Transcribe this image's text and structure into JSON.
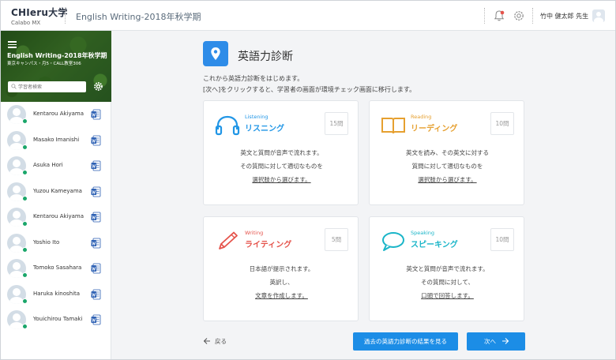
{
  "header": {
    "brand": "CHIeru大学",
    "brand_sub": "Calabo MX",
    "course_title": "English Writing-2018年秋学期",
    "teacher": "竹中 健太郎 先生",
    "icons": [
      "bell-icon",
      "gear-icon",
      "user-avatar-icon"
    ],
    "bell_badge_color": "#e5534b"
  },
  "sidebar": {
    "course": "English Writing-2018年秋学期",
    "place": "東京キャンパス・月5・CALL教室306",
    "search_placeholder": "学習者検索",
    "students": [
      {
        "name": "Kentarou Akiyama"
      },
      {
        "name": "Masako Imanishi"
      },
      {
        "name": "Asuka Hori"
      },
      {
        "name": "Yuzou Kameyama"
      },
      {
        "name": "Kentarou Akiyama"
      },
      {
        "name": "Yoshio Ito"
      },
      {
        "name": "Tomoko Sasahara"
      },
      {
        "name": "Haruka kinoshita"
      },
      {
        "name": "Youichirou Tamaki"
      }
    ],
    "online_color": "#1aa66a",
    "word_icon_color": "#2b5fb3"
  },
  "main": {
    "title": "英語力診断",
    "intro1": "これから英語力診断をはじめます。",
    "intro2": "[次へ]をクリックすると、学習者の画面が環境チェック画面に移行します。",
    "cards": [
      {
        "en": "Listening",
        "jp": "リスニング",
        "count": "15問",
        "lines": [
          "英文と質問が音声で流れます。",
          "その質問に対して適切なものを",
          "選択肢から選びます。"
        ],
        "color": "#2196e6",
        "icon": "headphones-icon"
      },
      {
        "en": "Reading",
        "jp": "リーディング",
        "count": "10問",
        "lines": [
          "英文を読み、その英文に対する",
          "質問に対して適切なものを",
          "選択肢から選びます。"
        ],
        "color": "#e6a030",
        "icon": "book-icon"
      },
      {
        "en": "Writing",
        "jp": "ライティング",
        "count": "5問",
        "lines": [
          "日本語が提示されます。",
          "英訳し、",
          "文章を作成します。"
        ],
        "color": "#e5534b",
        "icon": "pencil-icon"
      },
      {
        "en": "Speaking",
        "jp": "スピーキング",
        "count": "10問",
        "lines": [
          "英文と質問が音声で流れます。",
          "その質問に対して、",
          "口頭で回答します。"
        ],
        "color": "#1ab5c8",
        "icon": "speech-bubble-icon"
      }
    ],
    "back_label": "戻る",
    "result_button": "過去の英語力診断の結果を見る",
    "next_button": "次へ",
    "accent": "#1c8de6"
  }
}
